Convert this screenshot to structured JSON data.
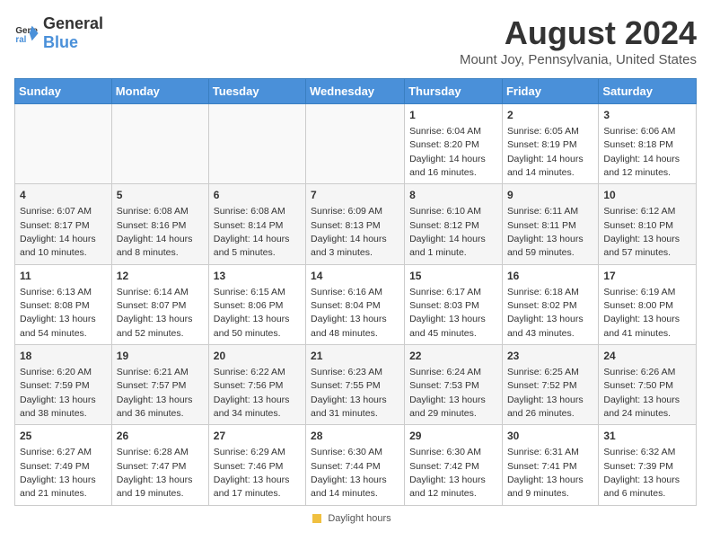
{
  "header": {
    "logo_general": "General",
    "logo_blue": "Blue",
    "title": "August 2024",
    "subtitle": "Mount Joy, Pennsylvania, United States"
  },
  "days_of_week": [
    "Sunday",
    "Monday",
    "Tuesday",
    "Wednesday",
    "Thursday",
    "Friday",
    "Saturday"
  ],
  "footer": {
    "daylight_label": "Daylight hours"
  },
  "weeks": [
    [
      {
        "day": "",
        "info": ""
      },
      {
        "day": "",
        "info": ""
      },
      {
        "day": "",
        "info": ""
      },
      {
        "day": "",
        "info": ""
      },
      {
        "day": "1",
        "info": "Sunrise: 6:04 AM\nSunset: 8:20 PM\nDaylight: 14 hours and 16 minutes."
      },
      {
        "day": "2",
        "info": "Sunrise: 6:05 AM\nSunset: 8:19 PM\nDaylight: 14 hours and 14 minutes."
      },
      {
        "day": "3",
        "info": "Sunrise: 6:06 AM\nSunset: 8:18 PM\nDaylight: 14 hours and 12 minutes."
      }
    ],
    [
      {
        "day": "4",
        "info": "Sunrise: 6:07 AM\nSunset: 8:17 PM\nDaylight: 14 hours and 10 minutes."
      },
      {
        "day": "5",
        "info": "Sunrise: 6:08 AM\nSunset: 8:16 PM\nDaylight: 14 hours and 8 minutes."
      },
      {
        "day": "6",
        "info": "Sunrise: 6:08 AM\nSunset: 8:14 PM\nDaylight: 14 hours and 5 minutes."
      },
      {
        "day": "7",
        "info": "Sunrise: 6:09 AM\nSunset: 8:13 PM\nDaylight: 14 hours and 3 minutes."
      },
      {
        "day": "8",
        "info": "Sunrise: 6:10 AM\nSunset: 8:12 PM\nDaylight: 14 hours and 1 minute."
      },
      {
        "day": "9",
        "info": "Sunrise: 6:11 AM\nSunset: 8:11 PM\nDaylight: 13 hours and 59 minutes."
      },
      {
        "day": "10",
        "info": "Sunrise: 6:12 AM\nSunset: 8:10 PM\nDaylight: 13 hours and 57 minutes."
      }
    ],
    [
      {
        "day": "11",
        "info": "Sunrise: 6:13 AM\nSunset: 8:08 PM\nDaylight: 13 hours and 54 minutes."
      },
      {
        "day": "12",
        "info": "Sunrise: 6:14 AM\nSunset: 8:07 PM\nDaylight: 13 hours and 52 minutes."
      },
      {
        "day": "13",
        "info": "Sunrise: 6:15 AM\nSunset: 8:06 PM\nDaylight: 13 hours and 50 minutes."
      },
      {
        "day": "14",
        "info": "Sunrise: 6:16 AM\nSunset: 8:04 PM\nDaylight: 13 hours and 48 minutes."
      },
      {
        "day": "15",
        "info": "Sunrise: 6:17 AM\nSunset: 8:03 PM\nDaylight: 13 hours and 45 minutes."
      },
      {
        "day": "16",
        "info": "Sunrise: 6:18 AM\nSunset: 8:02 PM\nDaylight: 13 hours and 43 minutes."
      },
      {
        "day": "17",
        "info": "Sunrise: 6:19 AM\nSunset: 8:00 PM\nDaylight: 13 hours and 41 minutes."
      }
    ],
    [
      {
        "day": "18",
        "info": "Sunrise: 6:20 AM\nSunset: 7:59 PM\nDaylight: 13 hours and 38 minutes."
      },
      {
        "day": "19",
        "info": "Sunrise: 6:21 AM\nSunset: 7:57 PM\nDaylight: 13 hours and 36 minutes."
      },
      {
        "day": "20",
        "info": "Sunrise: 6:22 AM\nSunset: 7:56 PM\nDaylight: 13 hours and 34 minutes."
      },
      {
        "day": "21",
        "info": "Sunrise: 6:23 AM\nSunset: 7:55 PM\nDaylight: 13 hours and 31 minutes."
      },
      {
        "day": "22",
        "info": "Sunrise: 6:24 AM\nSunset: 7:53 PM\nDaylight: 13 hours and 29 minutes."
      },
      {
        "day": "23",
        "info": "Sunrise: 6:25 AM\nSunset: 7:52 PM\nDaylight: 13 hours and 26 minutes."
      },
      {
        "day": "24",
        "info": "Sunrise: 6:26 AM\nSunset: 7:50 PM\nDaylight: 13 hours and 24 minutes."
      }
    ],
    [
      {
        "day": "25",
        "info": "Sunrise: 6:27 AM\nSunset: 7:49 PM\nDaylight: 13 hours and 21 minutes."
      },
      {
        "day": "26",
        "info": "Sunrise: 6:28 AM\nSunset: 7:47 PM\nDaylight: 13 hours and 19 minutes."
      },
      {
        "day": "27",
        "info": "Sunrise: 6:29 AM\nSunset: 7:46 PM\nDaylight: 13 hours and 17 minutes."
      },
      {
        "day": "28",
        "info": "Sunrise: 6:30 AM\nSunset: 7:44 PM\nDaylight: 13 hours and 14 minutes."
      },
      {
        "day": "29",
        "info": "Sunrise: 6:30 AM\nSunset: 7:42 PM\nDaylight: 13 hours and 12 minutes."
      },
      {
        "day": "30",
        "info": "Sunrise: 6:31 AM\nSunset: 7:41 PM\nDaylight: 13 hours and 9 minutes."
      },
      {
        "day": "31",
        "info": "Sunrise: 6:32 AM\nSunset: 7:39 PM\nDaylight: 13 hours and 6 minutes."
      }
    ]
  ]
}
